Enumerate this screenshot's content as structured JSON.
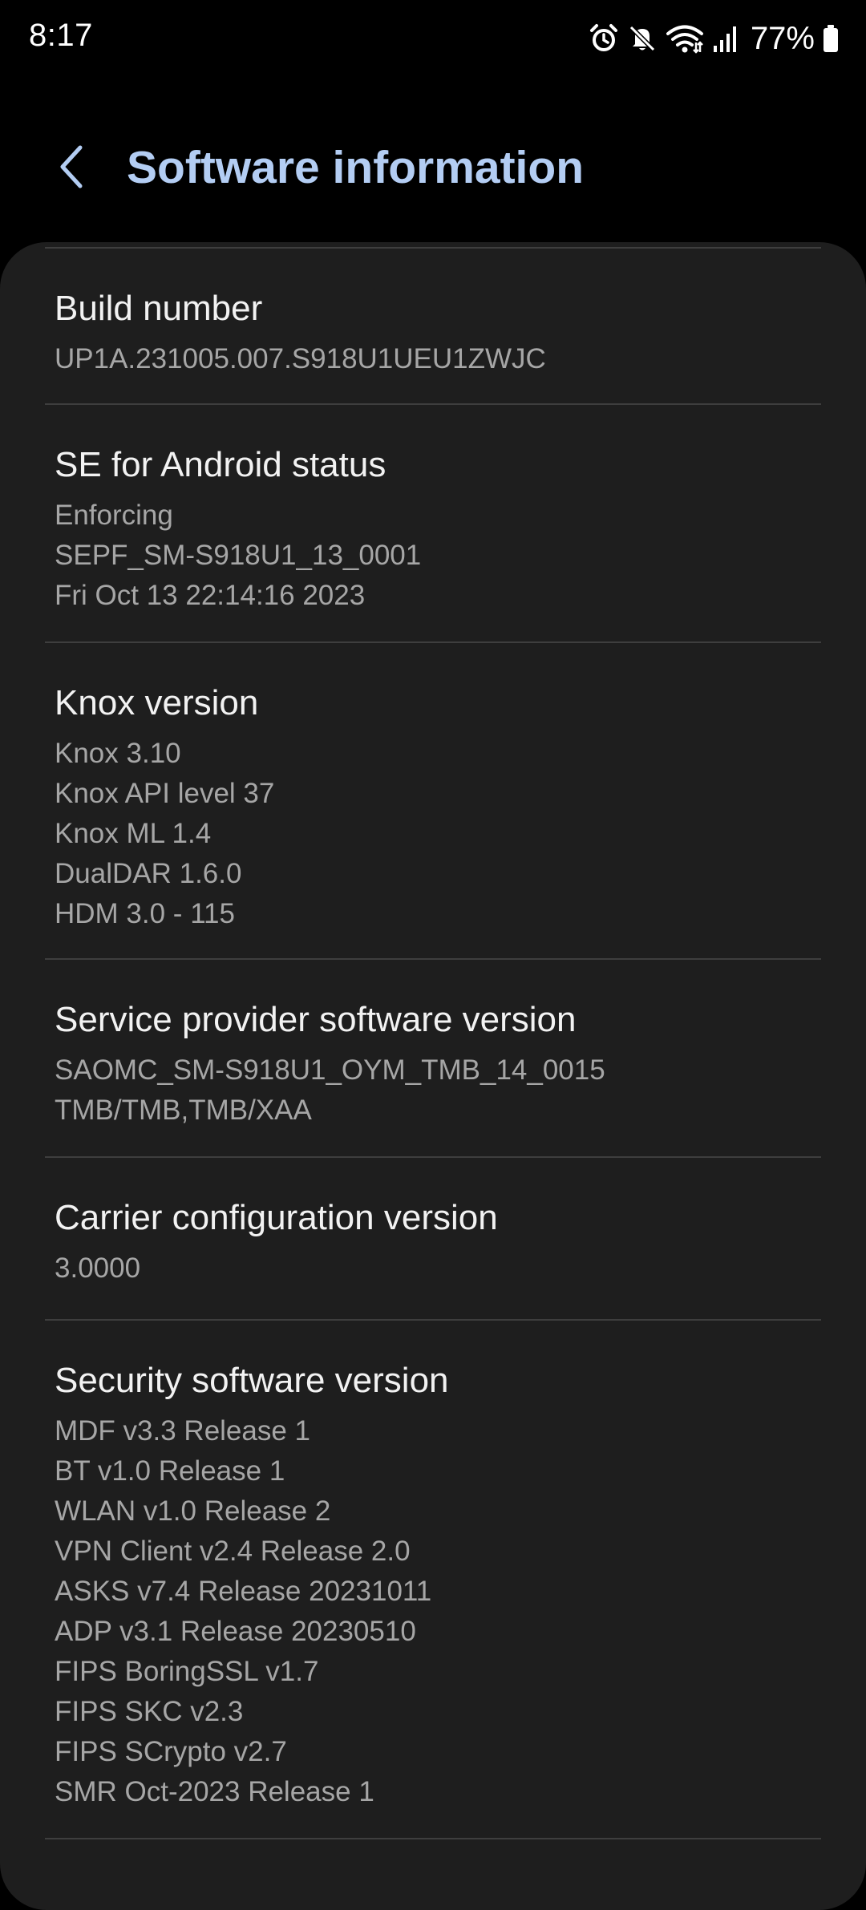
{
  "status_bar": {
    "time": "8:17",
    "battery_percent": "77%",
    "icons": [
      "alarm-icon",
      "mute-icon",
      "wifi-icon",
      "signal-icon",
      "battery-icon"
    ]
  },
  "header": {
    "title": "Software information",
    "title_color": "#b3cdf3"
  },
  "items": [
    {
      "title": "Build number",
      "lines": [
        "UP1A.231005.007.S918U1UEU1ZWJC"
      ]
    },
    {
      "title": "SE for Android status",
      "lines": [
        "Enforcing",
        "SEPF_SM-S918U1_13_0001",
        "Fri Oct 13 22:14:16 2023"
      ]
    },
    {
      "title": "Knox version",
      "lines": [
        "Knox 3.10",
        "Knox API level 37",
        "Knox ML 1.4",
        "DualDAR 1.6.0",
        "HDM 3.0 - 115"
      ]
    },
    {
      "title": "Service provider software version",
      "lines": [
        "SAOMC_SM-S918U1_OYM_TMB_14_0015",
        "TMB/TMB,TMB/XAA"
      ]
    },
    {
      "title": "Carrier configuration version",
      "lines": [
        "3.0000"
      ]
    },
    {
      "title": "Security software version",
      "lines": [
        "MDF v3.3 Release 1",
        "BT v1.0 Release 1",
        "WLAN v1.0 Release 2",
        "VPN Client v2.4 Release 2.0",
        "ASKS v7.4  Release 20231011",
        "ADP v3.1 Release 20230510",
        "FIPS BoringSSL v1.7",
        "FIPS SKC v2.3",
        "FIPS SCrypto v2.7",
        "SMR Oct-2023 Release 1"
      ]
    }
  ]
}
